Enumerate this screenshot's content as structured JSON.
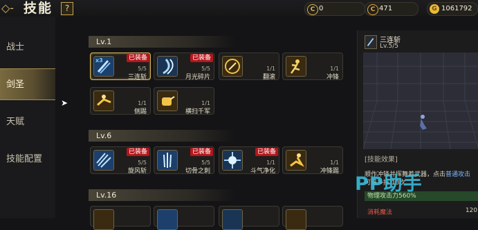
{
  "header": {
    "back_icon": "back-arrow-icon",
    "title": "技能",
    "help_label": "?"
  },
  "currencies": [
    {
      "icon": "coin-c-icon",
      "symbol": "C",
      "value": "0",
      "color": "#d9b45a"
    },
    {
      "icon": "coin-c-icon",
      "symbol": "C",
      "value": "471",
      "color": "#e0a840"
    },
    {
      "icon": "gold-coin-icon",
      "symbol": "G",
      "value": "1061792",
      "color": "#e9b93a"
    }
  ],
  "sidebar": {
    "items": [
      {
        "label": "战士",
        "active": false
      },
      {
        "label": "剑圣",
        "active": true
      },
      {
        "label": "天赋",
        "active": false
      },
      {
        "label": "技能配置",
        "active": false
      }
    ]
  },
  "groups": [
    {
      "level": "Lv.1",
      "skills": [
        {
          "name": "三连斩",
          "count": "5/5",
          "equipped": "已装备",
          "icon": "triple-slash-icon",
          "multiplier": "x3",
          "selected": true
        },
        {
          "name": "月光碎片",
          "count": "5/5",
          "equipped": "已装备",
          "icon": "moonlight-shard-icon"
        },
        {
          "name": "翻滚",
          "count": "1/1",
          "icon": "roll-icon"
        },
        {
          "name": "冲锋",
          "count": "1/1",
          "icon": "charge-icon"
        },
        {
          "name": "侧踢",
          "count": "1/1",
          "icon": "side-kick-icon"
        },
        {
          "name": "横扫千军",
          "count": "1/1",
          "icon": "sweep-icon"
        }
      ]
    },
    {
      "level": "Lv.6",
      "skills": [
        {
          "name": "旋风斩",
          "count": "5/5",
          "equipped": "已装备",
          "icon": "whirlwind-icon"
        },
        {
          "name": "切骨之刺",
          "count": "5/5",
          "equipped": "已装备",
          "icon": "bone-pierce-icon"
        },
        {
          "name": "斗气净化",
          "count": "1/1",
          "equipped": "已装备",
          "icon": "aura-purify-icon"
        },
        {
          "name": "冲锋踢",
          "count": "1/1",
          "icon": "charge-kick-icon"
        }
      ]
    },
    {
      "level": "Lv.16",
      "skills": []
    }
  ],
  "detail": {
    "name": "三连斩",
    "level": "Lv.5/5",
    "effect_label": "[技能效果]",
    "desc_before": "顺作冲锋并挥舞着武器，点击",
    "desc_highlight": "普通攻击",
    "desc_after": "可最多挥  13次",
    "physical": "物理攻击力560%",
    "cost_label": "消耗魔法",
    "cost_value": "120"
  },
  "watermark": "PP助手"
}
